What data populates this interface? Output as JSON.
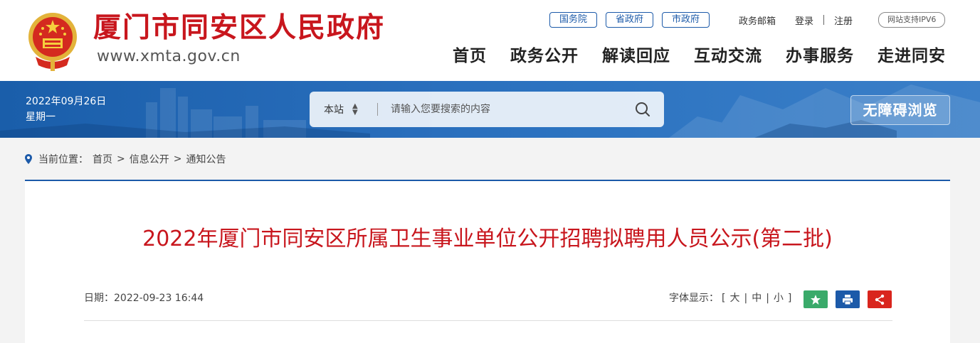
{
  "header": {
    "site_name": "厦门市同安区人民政府",
    "site_url": "www.xmta.gov.cn",
    "gov_links": [
      {
        "label": "国务院"
      },
      {
        "label": "省政府"
      },
      {
        "label": "市政府"
      }
    ],
    "util_links": {
      "mailbox": "政务邮箱",
      "login": "登录",
      "register": "注册"
    },
    "ipv6_badge": "网站支持IPV6",
    "nav": [
      {
        "label": "首页"
      },
      {
        "label": "政务公开"
      },
      {
        "label": "解读回应"
      },
      {
        "label": "互动交流"
      },
      {
        "label": "办事服务"
      },
      {
        "label": "走进同安"
      }
    ]
  },
  "banner": {
    "date": "2022年09月26日",
    "weekday": "星期一",
    "search": {
      "scope": "本站",
      "placeholder": "请输入您要搜索的内容"
    },
    "accessibility_label": "无障碍浏览"
  },
  "breadcrumb": {
    "prefix": "当前位置：",
    "items": [
      {
        "label": "首页"
      },
      {
        "label": "信息公开"
      },
      {
        "label": "通知公告"
      }
    ],
    "separator": ">"
  },
  "article": {
    "title": "2022年厦门市同安区所属卫生事业单位公开招聘拟聘用人员公示(第二批)",
    "date_label": "日期：",
    "date_value": "2022-09-23 16:44",
    "font_size": {
      "label": "字体显示：",
      "open_bracket": "[",
      "close_bracket": "]",
      "large": "大",
      "medium": "中",
      "small": "小",
      "sep": "|"
    }
  },
  "colors": {
    "brand_red": "#c8161d",
    "brand_blue": "#1c5aa9",
    "favorite_green": "#3aaa6a"
  },
  "icons": {
    "emblem": "national-emblem-icon",
    "location": "location-pin-icon",
    "search": "search-icon",
    "favorite": "star-icon",
    "print": "print-icon",
    "share": "share-icon"
  }
}
